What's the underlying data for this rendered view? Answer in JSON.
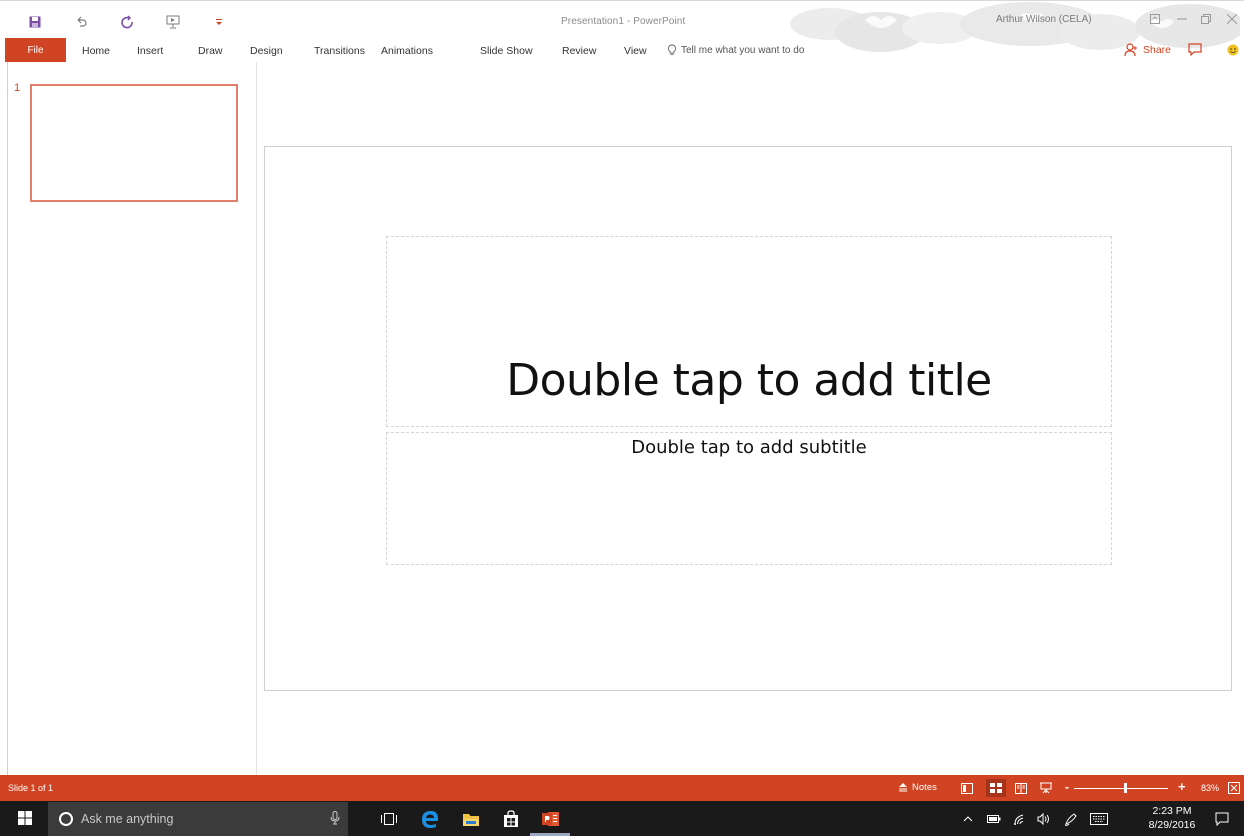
{
  "window": {
    "title": "Presentation1  -  PowerPoint",
    "user": "Arthur Wilson (CELA)"
  },
  "quick_access": [
    {
      "icon": "save-icon"
    },
    {
      "icon": "undo-icon"
    },
    {
      "icon": "redo-icon"
    },
    {
      "icon": "start-from-beginning-icon"
    },
    {
      "icon": "customize-toolbar-icon"
    }
  ],
  "ribbon": {
    "file_label": "File",
    "tabs": [
      "Home",
      "Insert",
      "Draw",
      "Design",
      "Transitions",
      "Animations",
      "Slide Show",
      "Review",
      "View"
    ],
    "tell_me": "Tell me what you want to do",
    "share_label": "Share"
  },
  "thumbnails": {
    "items": [
      {
        "number": "1"
      }
    ]
  },
  "slide": {
    "title_placeholder": "Double tap to add title",
    "subtitle_placeholder": "Double tap to add subtitle"
  },
  "status": {
    "slide_count": "Slide 1 of 1",
    "notes_label": "Notes",
    "zoom_minus": "-",
    "zoom_plus": "+",
    "zoom_percent": "83%",
    "zoom_level": 0.83
  },
  "taskbar": {
    "search_placeholder": "Ask me anything",
    "time": "2:23 PM",
    "date": "8/29/2016"
  },
  "colors": {
    "accent": "#d04423",
    "taskbar": "#1a1a1a"
  }
}
